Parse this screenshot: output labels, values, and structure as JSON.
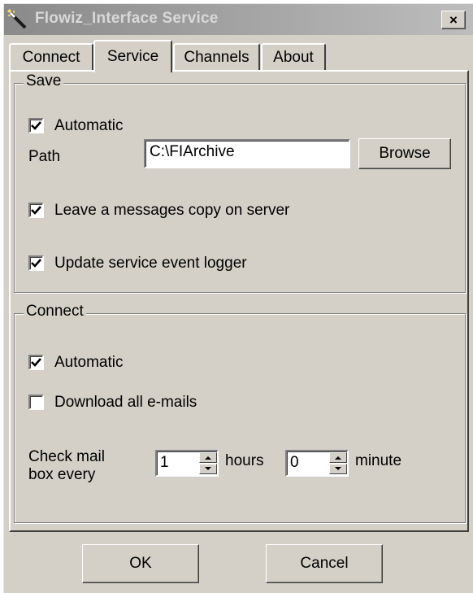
{
  "window": {
    "title": "Flowiz_Interface Service",
    "close_glyph": "×"
  },
  "tabs": [
    {
      "label": "Connect",
      "active": false
    },
    {
      "label": "Service",
      "active": true
    },
    {
      "label": "Channels",
      "active": false
    },
    {
      "label": "About",
      "active": false
    }
  ],
  "save_group": {
    "legend": "Save",
    "automatic": {
      "label": "Automatic",
      "checked": true
    },
    "path_label": "Path",
    "path_value": "C:\\FIArchive",
    "browse_label": "Browse",
    "leave_copy": {
      "label": "Leave a messages copy on server",
      "checked": true
    },
    "update_logger": {
      "label": "Update service event logger",
      "checked": true
    }
  },
  "connect_group": {
    "legend": "Connect",
    "automatic": {
      "label": "Automatic",
      "checked": true
    },
    "download_all": {
      "label": "Download all e-mails",
      "checked": false
    },
    "check_label_line1": "Check mail",
    "check_label_line2": "box every",
    "hours_value": "1",
    "hours_label": "hours",
    "minutes_value": "0",
    "minutes_label": "minute"
  },
  "footer": {
    "ok_label": "OK",
    "cancel_label": "Cancel"
  },
  "icons": {
    "app": "magic-wand-icon",
    "check": "checkmark-icon",
    "spin_up": "triangle-up-icon",
    "spin_down": "triangle-down-icon"
  }
}
